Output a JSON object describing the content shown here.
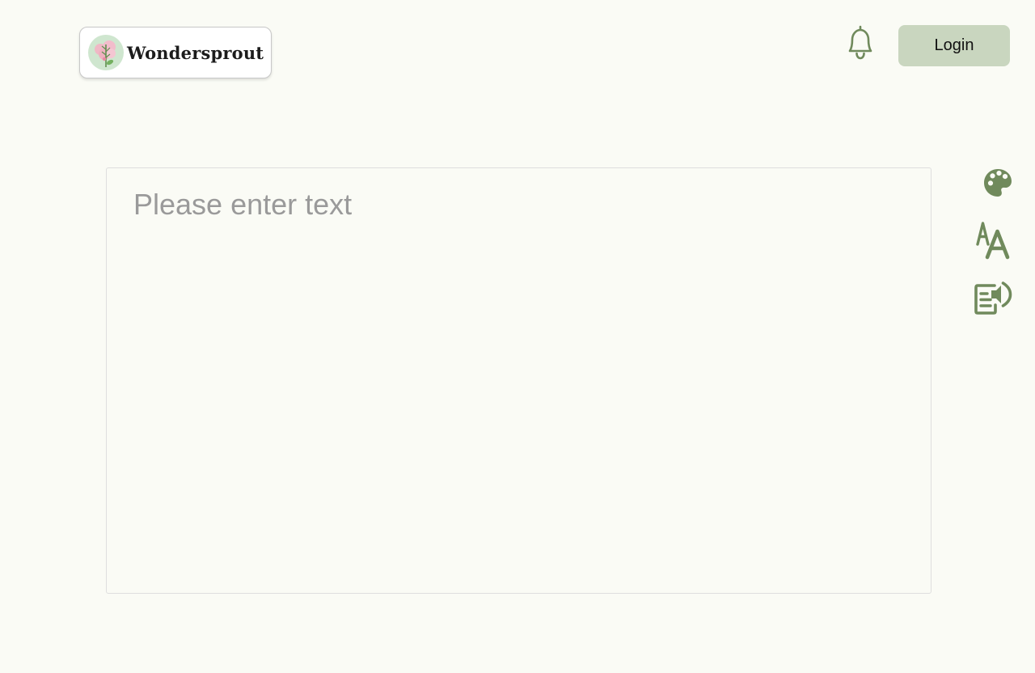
{
  "header": {
    "logo": {
      "text": "Wondersprout",
      "icon": "flower-logo-icon"
    },
    "notification_icon": "bell-icon",
    "login_label": "Login"
  },
  "editor": {
    "placeholder": "Please enter text",
    "value": ""
  },
  "toolbar": {
    "items": [
      {
        "icon": "palette-icon"
      },
      {
        "icon": "font-size-icon"
      },
      {
        "icon": "read-aloud-icon"
      }
    ]
  },
  "colors": {
    "background": "#fafbf5",
    "accent": "#708a5c",
    "button_bg": "#c9d6bf",
    "placeholder": "#9a9a9a"
  }
}
